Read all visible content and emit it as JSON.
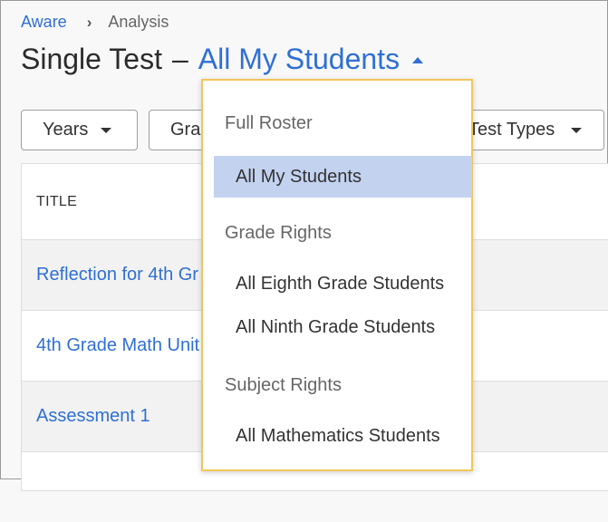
{
  "breadcrumb": {
    "root": "Aware",
    "separator": "›",
    "current": "Analysis"
  },
  "header": {
    "title_prefix": "Single Test",
    "dash": "–",
    "selected_roster": "All My Students"
  },
  "filters": {
    "years": "Years",
    "grade": "Gra",
    "test_types": "Test Types"
  },
  "table": {
    "column_title": "TITLE",
    "rows": [
      "Reflection for 4th Gr",
      "4th Grade Math Unit",
      "Assessment 1"
    ]
  },
  "dropdown": {
    "groups": [
      {
        "label": "Full Roster",
        "options": [
          "All My Students"
        ]
      },
      {
        "label": "Grade Rights",
        "options": [
          "All Eighth Grade Students",
          "All Ninth Grade Students"
        ]
      },
      {
        "label": "Subject Rights",
        "options": [
          "All Mathematics Students"
        ]
      }
    ],
    "selected": "All My Students"
  },
  "colors": {
    "accent": "#2f6fd4",
    "selected_bg": "#c3d2ef",
    "dropdown_border": "#f1c65a"
  }
}
